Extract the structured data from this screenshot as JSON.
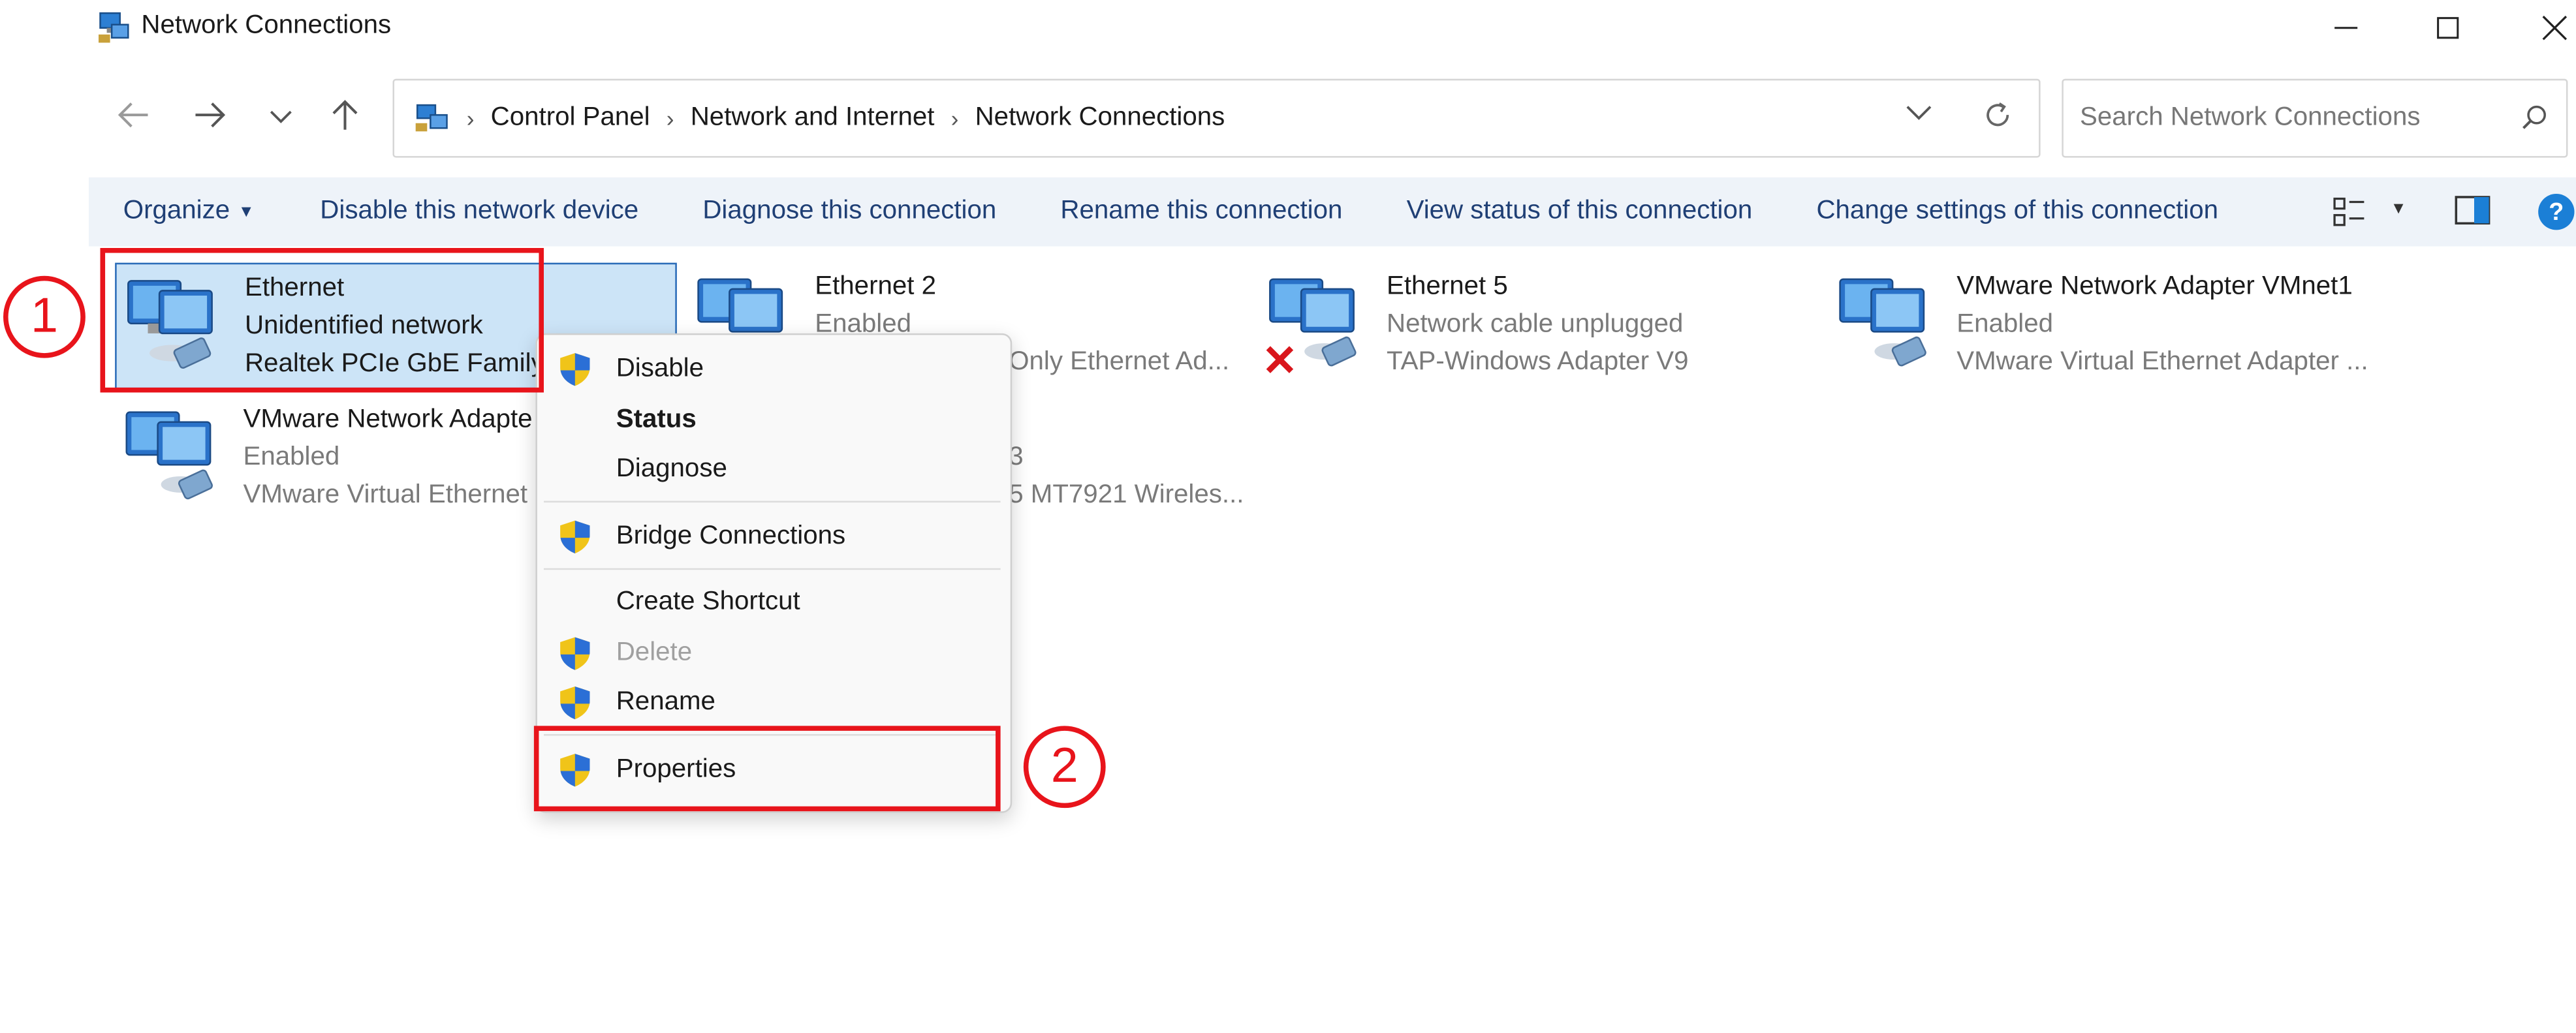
{
  "window": {
    "title": "Network Connections"
  },
  "address": {
    "crumbs": [
      "Control Panel",
      "Network and Internet",
      "Network Connections"
    ]
  },
  "search": {
    "placeholder": "Search Network Connections"
  },
  "toolbar": {
    "organize": "Organize",
    "items": [
      "Disable this network device",
      "Diagnose this connection",
      "Rename this connection",
      "View status of this connection",
      "Change settings of this connection"
    ]
  },
  "adapters": [
    {
      "name": "Ethernet",
      "status": "Unidentified network",
      "device": "Realtek PCIe GbE Family",
      "selected": true
    },
    {
      "name": "Ethernet 2",
      "status": "Enabled",
      "device": "Only Ethernet Ad..."
    },
    {
      "name": "Ethernet 5",
      "status": "Network cable unplugged",
      "device": "TAP-Windows Adapter V9",
      "disconnected": true
    },
    {
      "name": "VMware Network Adapter VMnet1",
      "status": "Enabled",
      "device": "VMware Virtual Ethernet Adapter ..."
    },
    {
      "name": "VMware Network Adapte",
      "status": "Enabled",
      "device": "VMware Virtual Ethernet"
    },
    {
      "name": "",
      "status": "3",
      "device": "5 MT7921 Wireles..."
    }
  ],
  "context_menu": {
    "items": [
      {
        "label": "Disable",
        "shield": true
      },
      {
        "label": "Status",
        "bold": true
      },
      {
        "label": "Diagnose"
      },
      {
        "label": "Bridge Connections",
        "shield": true
      },
      {
        "label": "Create Shortcut"
      },
      {
        "label": "Delete",
        "shield": true,
        "disabled": true
      },
      {
        "label": "Rename",
        "shield": true
      },
      {
        "label": "Properties",
        "shield": true
      }
    ]
  },
  "annotations": {
    "step1": "1",
    "step2": "2"
  },
  "colors": {
    "annotation_red": "#e8141b",
    "selection_bg": "#cce4f7",
    "toolbar_bg": "#eef3f9",
    "help_blue": "#1b7fd6"
  }
}
